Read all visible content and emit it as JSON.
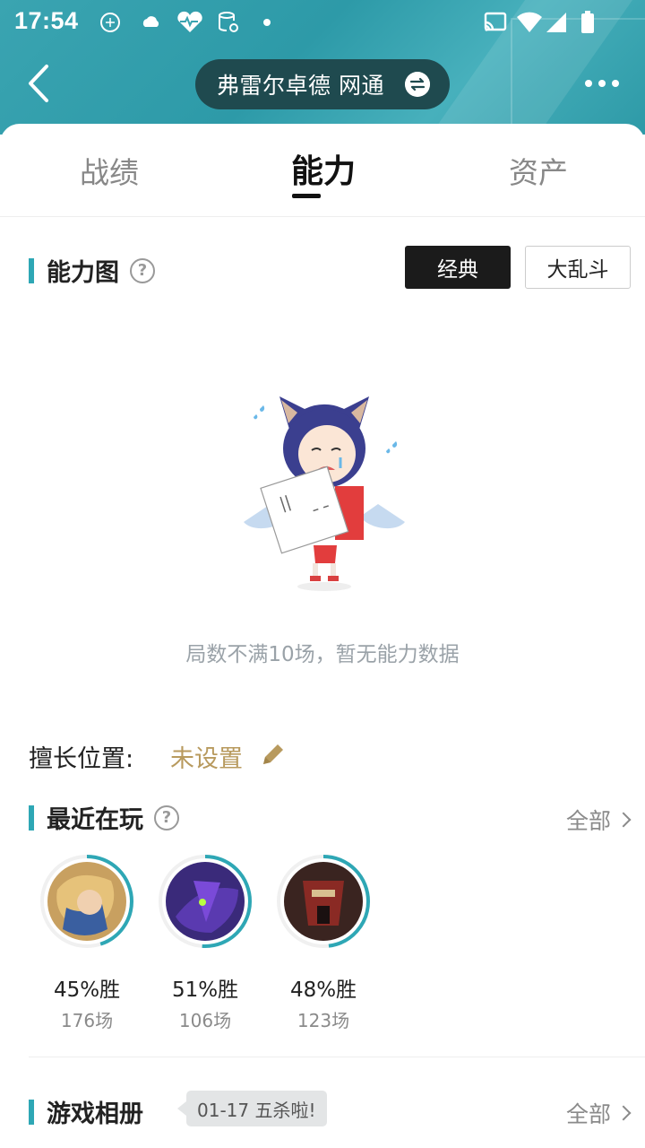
{
  "status_bar": {
    "time": "17:54"
  },
  "header": {
    "title": "弗雷尔卓德 网通"
  },
  "tabs": [
    {
      "label": "战绩"
    },
    {
      "label": "能力"
    },
    {
      "label": "资产"
    }
  ],
  "ability": {
    "title": "能力图",
    "mode_classic": "经典",
    "mode_aram": "大乱斗",
    "empty_message": "局数不满10场，暂无能力数据"
  },
  "position": {
    "label": "擅长位置:",
    "value": "未设置"
  },
  "recent": {
    "title": "最近在玩",
    "all_label": "全部",
    "champions": [
      {
        "win_rate": "45%胜",
        "games": "176场",
        "win_fraction": 0.45
      },
      {
        "win_rate": "51%胜",
        "games": "106场",
        "win_fraction": 0.51
      },
      {
        "win_rate": "48%胜",
        "games": "123场",
        "win_fraction": 0.48
      }
    ]
  },
  "album": {
    "title": "游戏相册",
    "tooltip": "01-17 五杀啦!",
    "all_label": "全部"
  },
  "colors": {
    "accent": "#2ea7b5",
    "gold": "#b89a5e"
  }
}
